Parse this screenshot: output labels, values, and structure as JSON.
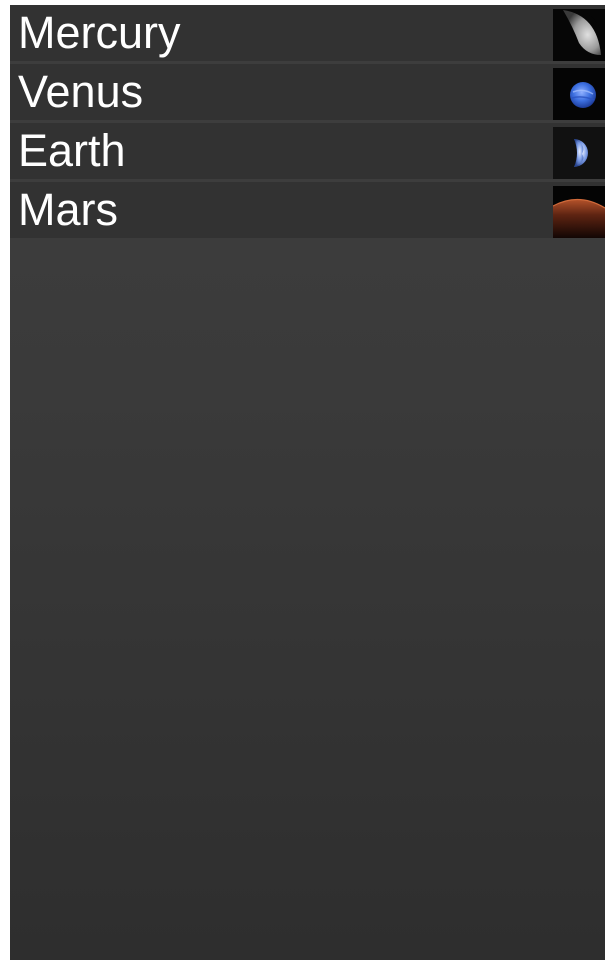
{
  "planets": [
    {
      "name": "Mercury",
      "thumbnail": "mercury-crescent-photo"
    },
    {
      "name": "Venus",
      "thumbnail": "venus-blue-photo"
    },
    {
      "name": "Earth",
      "thumbnail": "earth-crescent-photo"
    },
    {
      "name": "Mars",
      "thumbnail": "mars-limb-photo"
    }
  ],
  "colors": {
    "row_background": "#323232",
    "row_separator": "#3d3d3d",
    "list_background_top": "#3f3f3f",
    "list_background_bottom": "#2e2e2e",
    "text": "#ffffff"
  }
}
